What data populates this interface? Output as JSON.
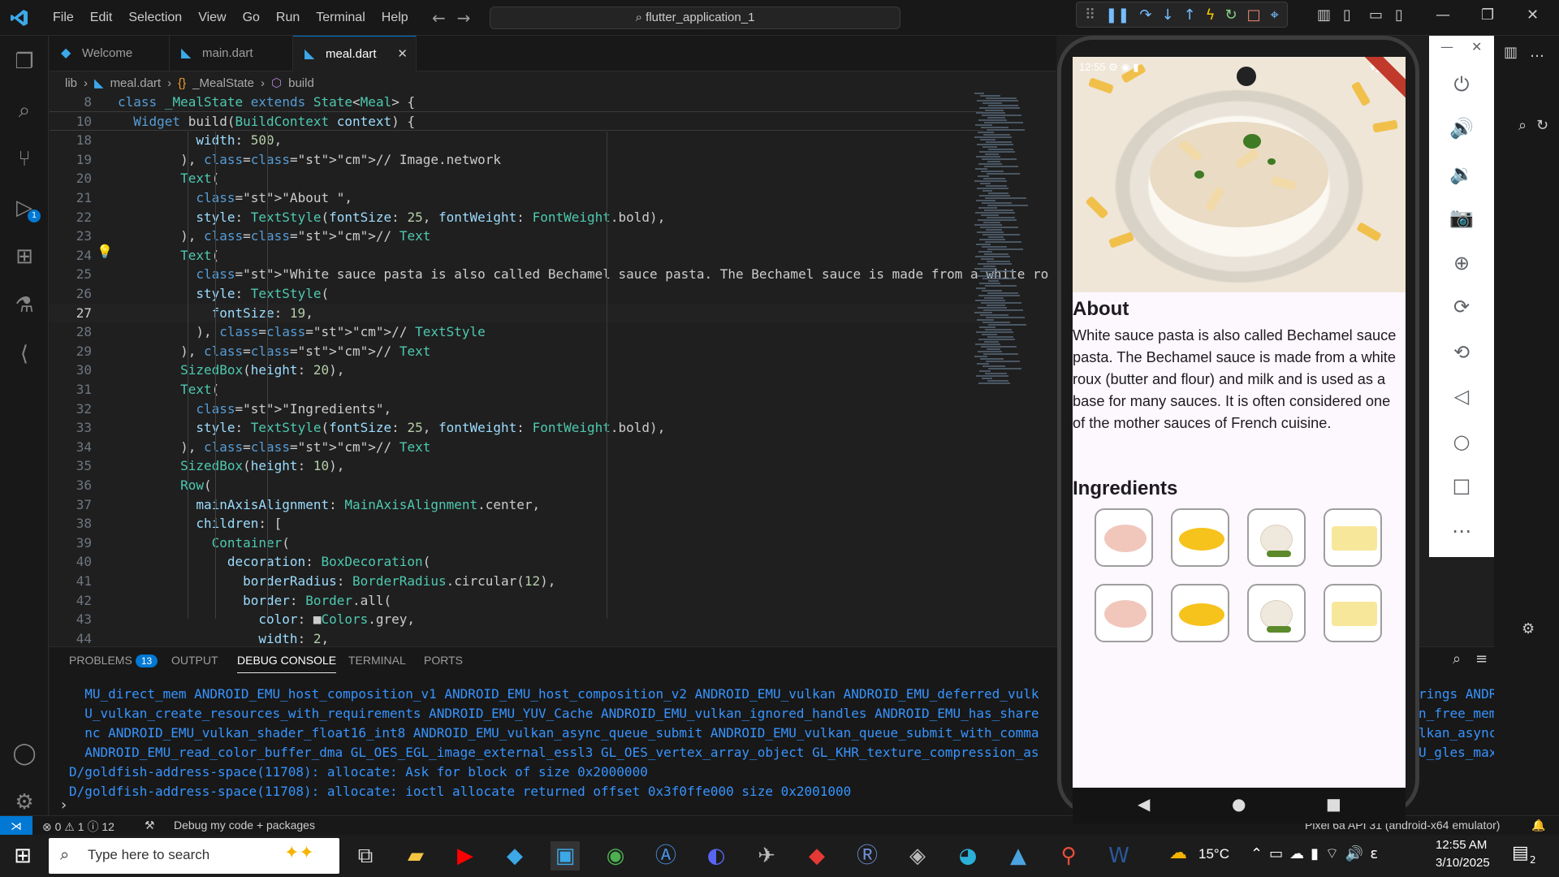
{
  "window": {
    "menu": [
      "File",
      "Edit",
      "Selection",
      "View",
      "Go",
      "Run",
      "Terminal",
      "Help"
    ],
    "search": "flutter_application_1"
  },
  "tabs": [
    {
      "label": "Welcome"
    },
    {
      "label": "main.dart"
    },
    {
      "label": "meal.dart",
      "active": true
    }
  ],
  "breadcrumb": [
    "lib",
    "meal.dart",
    "_MealState",
    "build"
  ],
  "editor": {
    "sticky": [
      {
        "num": "8",
        "text": "class _MealState extends State<Meal> {"
      },
      {
        "num": "10",
        "text": "  Widget build(BuildContext context) {"
      }
    ],
    "lines": [
      {
        "num": "18",
        "text": "          width: 500,"
      },
      {
        "num": "19",
        "text": "        ), // Image.network"
      },
      {
        "num": "20",
        "text": "        Text("
      },
      {
        "num": "21",
        "text": "          \"About \","
      },
      {
        "num": "22",
        "text": "          style: TextStyle(fontSize: 25, fontWeight: FontWeight.bold),"
      },
      {
        "num": "23",
        "text": "        ), // Text"
      },
      {
        "num": "24",
        "text": "        Text("
      },
      {
        "num": "25",
        "text": "          \"White sauce pasta is also called Bechamel sauce pasta. The Bechamel sauce is made from a white ro"
      },
      {
        "num": "26",
        "text": "          style: TextStyle("
      },
      {
        "num": "27",
        "text": "            fontSize: 19,"
      },
      {
        "num": "28",
        "text": "          ), // TextStyle"
      },
      {
        "num": "29",
        "text": "        ), // Text"
      },
      {
        "num": "30",
        "text": "        SizedBox(height: 20),"
      },
      {
        "num": "31",
        "text": "        Text("
      },
      {
        "num": "32",
        "text": "          \"Ingredients\","
      },
      {
        "num": "33",
        "text": "          style: TextStyle(fontSize: 25, fontWeight: FontWeight.bold),"
      },
      {
        "num": "34",
        "text": "        ), // Text"
      },
      {
        "num": "35",
        "text": "        SizedBox(height: 10),"
      },
      {
        "num": "36",
        "text": "        Row("
      },
      {
        "num": "37",
        "text": "          mainAxisAlignment: MainAxisAlignment.center,"
      },
      {
        "num": "38",
        "text": "          children: ["
      },
      {
        "num": "39",
        "text": "            Container("
      },
      {
        "num": "40",
        "text": "              decoration: BoxDecoration("
      },
      {
        "num": "41",
        "text": "                borderRadius: BorderRadius.circular(12),"
      },
      {
        "num": "42",
        "text": "                border: Border.all("
      },
      {
        "num": "43",
        "text": "                  color: ■Colors.grey,"
      },
      {
        "num": "44",
        "text": "                  width: 2,"
      }
    ]
  },
  "panel": {
    "tabs": [
      "PROBLEMS",
      "OUTPUT",
      "DEBUG CONSOLE",
      "TERMINAL",
      "PORTS"
    ],
    "problems_count": "13",
    "lines": [
      "  MU_direct_mem ANDROID_EMU_host_composition_v1 ANDROID_EMU_host_composition_v2 ANDROID_EMU_vulkan ANDROID_EMU_deferred_vulk",
      "  U_vulkan_create_resources_with_requirements ANDROID_EMU_YUV_Cache ANDROID_EMU_vulkan_ignored_handles ANDROID_EMU_has_share",
      "  nc ANDROID_EMU_vulkan_shader_float16_int8 ANDROID_EMU_vulkan_async_queue_submit ANDROID_EMU_vulkan_queue_submit_with_comma",
      "  ANDROID_EMU_read_color_buffer_dma GL_OES_EGL_image_external_essl3 GL_OES_vertex_array_object GL_KHR_texture_compression_as",
      "D/goldfish-address-space(11708): allocate: Ask for block of size 0x2000000",
      "D/goldfish-address-space(11708): allocate: ioctl allocate returned offset 0x3f0ffe000 size 0x2001000"
    ],
    "right_lines": [
      "rings ANDROID_EM",
      "n_free_memory_sy",
      "lkan_async_qsri",
      "U_gles_max_versi"
    ]
  },
  "status": {
    "errors": "0",
    "warnings": "1",
    "infos": "12",
    "debug": "Debug my code + packages",
    "device": "Pixel 6a API 31 (android-x64 emulator)"
  },
  "phone": {
    "time": "12:55",
    "about_title": "About",
    "about_text": "White sauce pasta is also called Bechamel sauce pasta. The Bechamel sauce is made from a white roux (butter and flour) and milk and is used as a base for many sauces. It is often considered one of the mother sauces of French cuisine.",
    "ingredients_title": "Ingredients"
  },
  "taskbar": {
    "search_placeholder": "Type here to search",
    "temperature": "15°C",
    "time": "12:55 AM",
    "date": "3/10/2025",
    "notifications": "2"
  }
}
